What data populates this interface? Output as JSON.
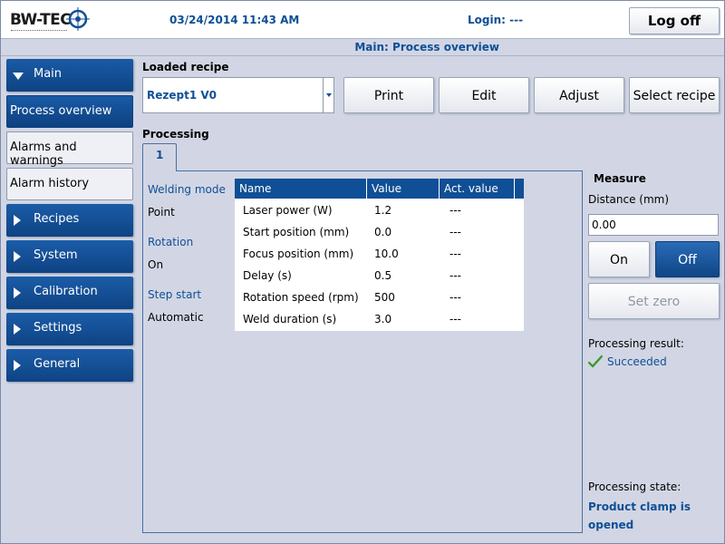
{
  "header": {
    "logo_text": "BW-TEC",
    "datetime": "03/24/2014 11:43 AM",
    "login": "Login: ---",
    "logoff_label": "Log off",
    "page_title": "Main: Process overview"
  },
  "sidebar": {
    "items": [
      {
        "label": "Main"
      },
      {
        "label": "Process overview"
      },
      {
        "label": "Alarms and warnings"
      },
      {
        "label": "Alarm history"
      },
      {
        "label": "Recipes"
      },
      {
        "label": "System"
      },
      {
        "label": "Calibration"
      },
      {
        "label": "Settings"
      },
      {
        "label": "General"
      }
    ]
  },
  "recipe": {
    "title": "Loaded recipe",
    "selected": "Rezept1 V0",
    "buttons": {
      "print": "Print",
      "edit": "Edit",
      "adjust": "Adjust",
      "select": "Select recipe"
    }
  },
  "processing": {
    "title": "Processing",
    "tab": "1",
    "welding_mode_label": "Welding mode",
    "welding_mode_value": "Point",
    "rotation_label": "Rotation",
    "rotation_value": "On",
    "step_start_label": "Step start",
    "step_start_value": "Automatic",
    "table": {
      "columns": [
        "Name",
        "Value",
        "Act. value"
      ],
      "rows": [
        [
          "Laser power (W)",
          "1.2",
          "---"
        ],
        [
          "Start position (mm)",
          "0.0",
          "---"
        ],
        [
          "Focus position (mm)",
          "10.0",
          "---"
        ],
        [
          "Delay (s)",
          "0.5",
          "---"
        ],
        [
          "Rotation speed (rpm)",
          "500",
          "---"
        ],
        [
          "Weld duration (s)",
          "3.0",
          "---"
        ]
      ]
    }
  },
  "measure": {
    "title": "Measure",
    "distance_label": "Distance (mm)",
    "distance_value": "0.00",
    "on_label": "On",
    "off_label": "Off",
    "set_zero_label": "Set zero",
    "result_label": "Processing result:",
    "result_value": "Succeeded",
    "state_label": "Processing state:",
    "state_value": "Product clamp is opened"
  },
  "colors": {
    "accent": "#0f4f96",
    "background": "#d2d6e4",
    "success": "#4caf3a"
  }
}
